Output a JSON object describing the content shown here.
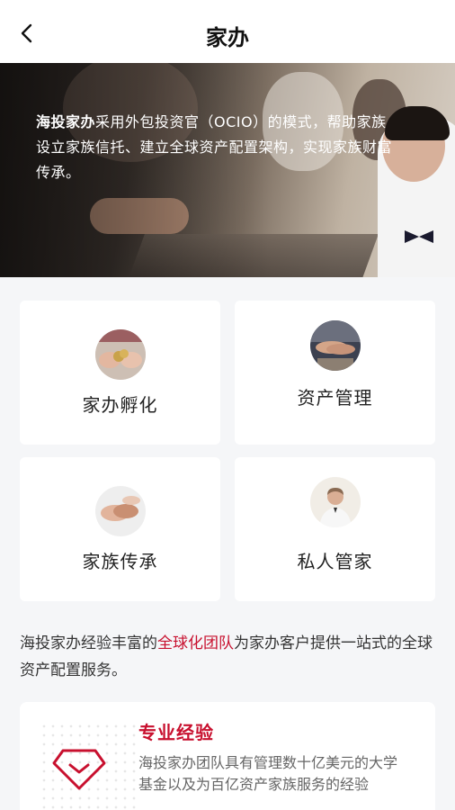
{
  "header": {
    "back_icon": "chevron-left-icon",
    "title": "家办"
  },
  "hero": {
    "brand": "海投家办",
    "text": "采用外包投资官（OCIO）的模式，帮助家族设立家族信托、建立全球资产配置架构，实现家族财富传承。"
  },
  "services": [
    {
      "label": "家办孵化",
      "icon": "coins-hands-icon"
    },
    {
      "label": "资产管理",
      "icon": "handshake-icon"
    },
    {
      "label": "家族传承",
      "icon": "holding-hands-icon"
    },
    {
      "label": "私人管家",
      "icon": "butler-icon"
    }
  ],
  "summary": {
    "prefix": "海投家办经验丰富的",
    "highlight": "全球化团队",
    "suffix": "为家办客户提供一站式的全球资产配置服务。"
  },
  "feature": {
    "icon": "diamond-icon",
    "title": "专业经验",
    "description": "海投家办团队具有管理数十亿美元的大学基金以及为百亿资产家族服务的经验"
  },
  "colors": {
    "accent": "#c8102e",
    "background": "#f5f6f8",
    "card": "#ffffff"
  }
}
